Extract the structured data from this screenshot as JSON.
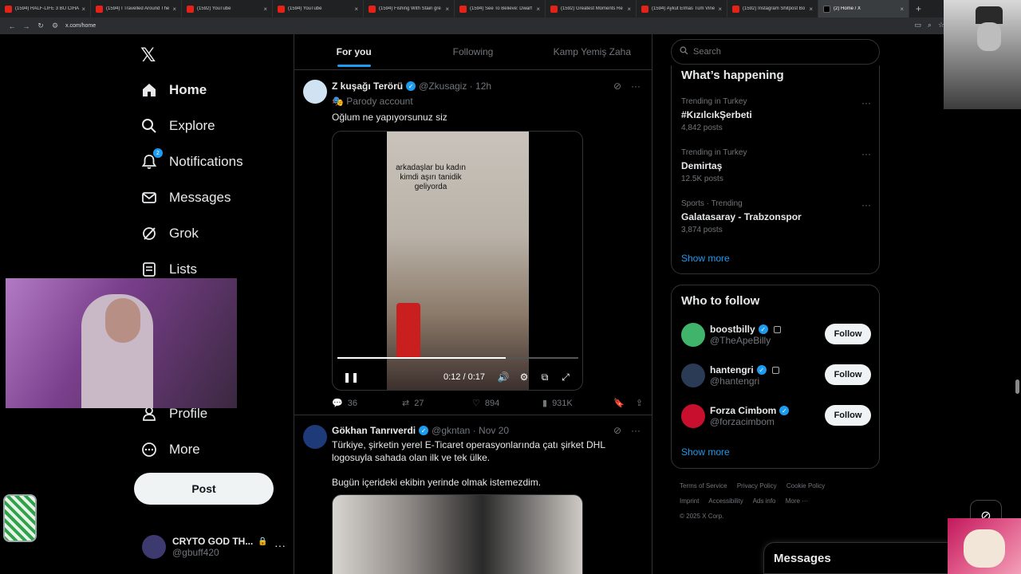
{
  "browser": {
    "tabs": [
      {
        "label": "(1594) HALF-LIFE 3 BU CİHAZ",
        "icon": "youtube-icon"
      },
      {
        "label": "(1594) I Travelled Around The",
        "icon": "youtube-icon"
      },
      {
        "label": "(1592) YouTube",
        "icon": "youtube-icon"
      },
      {
        "label": "(1594) YouTube",
        "icon": "youtube-icon"
      },
      {
        "label": "(1594) Fishing With Stain gre",
        "icon": "youtube-icon"
      },
      {
        "label": "(1594) See To Believe: Dwarf",
        "icon": "youtube-icon"
      },
      {
        "label": "(1592) Greatest Moments Re",
        "icon": "youtube-icon"
      },
      {
        "label": "(1594) Aykut Elmas Tüm Vine",
        "icon": "youtube-icon"
      },
      {
        "label": "(1592) İnstagram Shitpost Bo",
        "icon": "youtube-icon"
      },
      {
        "label": "(2) Home / X",
        "icon": "x-icon",
        "active": true
      }
    ],
    "url": "x.com/home"
  },
  "sidebar": {
    "logo": "𝕏",
    "items": [
      {
        "label": "Home",
        "icon": "home-icon",
        "active": true
      },
      {
        "label": "Explore",
        "icon": "search-icon"
      },
      {
        "label": "Notifications",
        "icon": "bell-icon",
        "badge": "2"
      },
      {
        "label": "Messages",
        "icon": "envelope-icon"
      },
      {
        "label": "Grok",
        "icon": "grok-icon"
      },
      {
        "label": "Lists",
        "icon": "list-icon"
      },
      {
        "label": "Profile",
        "icon": "person-icon"
      },
      {
        "label": "More",
        "icon": "more-circle-icon"
      }
    ],
    "post_label": "Post",
    "account": {
      "name": "CRYTO GOD TH...",
      "handle": "@gbuff420"
    }
  },
  "feed": {
    "tabs": [
      {
        "label": "For you",
        "active": true
      },
      {
        "label": "Following"
      },
      {
        "label": "Kamp Yemiş Zaha"
      }
    ],
    "tweets": [
      {
        "name": "Z kuşağı Terörü",
        "handle": "@Zkusagiz",
        "time": "12h",
        "parody": "Parody account",
        "text": "Oğlum ne yapıyorsunuz siz",
        "video": {
          "caption": "arkadaşlar bu kadın kimdi aşırı tanidik geliyorda",
          "time": "0:12 / 0:17",
          "progress": 0.7
        },
        "stats": {
          "replies": "36",
          "reposts": "27",
          "likes": "894",
          "views": "931K"
        }
      },
      {
        "name": "Gökhan Tanrıverdi",
        "handle": "@gkntan",
        "time": "Nov 20",
        "text1": "Türkiye, şirketin yerel E-Ticaret operasyonlarında çatı şirket DHL logosuyla sahada olan ilk ve tek ülke.",
        "text2": "Bugün içerideki ekibin yerinde olmak istemezdim."
      }
    ]
  },
  "right": {
    "search_placeholder": "Search",
    "happening_title": "What’s happening",
    "trends": [
      {
        "context": "Trending in Turkey",
        "topic": "#KızılcıkŞerbeti",
        "posts": "4,842 posts"
      },
      {
        "context": "Trending in Turkey",
        "topic": "Demirtaş",
        "posts": "12.5K posts"
      },
      {
        "context": "Sports · Trending",
        "topic": "Galatasaray - Trabzonspor",
        "posts": "3,874 posts"
      }
    ],
    "show_more": "Show more",
    "who_title": "Who to follow",
    "who": [
      {
        "name": "boostbilly",
        "handle": "@TheApeBilly",
        "color": "#3fb46a"
      },
      {
        "name": "hantengri",
        "handle": "@hantengri",
        "color": "#2b3a55"
      },
      {
        "name": "Forza Cimbom",
        "handle": "@forzacimbom",
        "color": "#c8102e"
      }
    ],
    "follow_label": "Follow",
    "footer": [
      "Terms of Service",
      "Privacy Policy",
      "Cookie Policy",
      "Imprint",
      "Accessibility",
      "Ads info",
      "More ···",
      "© 2025 X Corp."
    ]
  },
  "messages_label": "Messages",
  "colors": {
    "accent": "#1d9bf0",
    "background": "#000000",
    "border": "#2f3336",
    "muted": "#71767b"
  }
}
